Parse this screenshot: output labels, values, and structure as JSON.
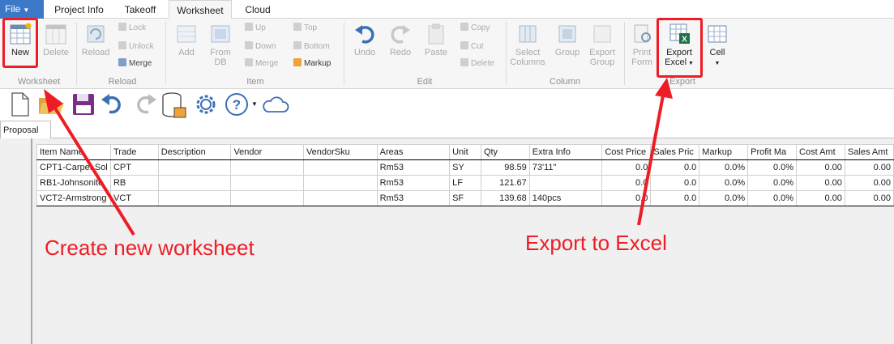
{
  "menu": {
    "file_label": "File",
    "tabs": [
      {
        "label": "Project Info"
      },
      {
        "label": "Takeoff"
      },
      {
        "label": "Worksheet"
      },
      {
        "label": "Cloud"
      }
    ]
  },
  "ribbon": {
    "worksheet_group": {
      "label": "Worksheet",
      "new_label": "New",
      "delete_label": "Delete"
    },
    "reload_group": {
      "label": "Reload",
      "reload_label": "Reload",
      "lock_label": "Lock",
      "unlock_label": "Unlock",
      "merge_label": "Merge"
    },
    "item_group": {
      "label": "Item",
      "add_label": "Add",
      "from_db_line1": "From",
      "from_db_line2": "DB",
      "up_label": "Up",
      "down_label": "Down",
      "merge_label": "Merge",
      "top_label": "Top",
      "bottom_label": "Bottom",
      "markup_label": "Markup"
    },
    "edit_group": {
      "label": "Edit",
      "undo_label": "Undo",
      "redo_label": "Redo",
      "paste_label": "Paste",
      "copy_label": "Copy",
      "cut_label": "Cut",
      "delete_label": "Delete"
    },
    "column_group": {
      "label": "Column",
      "select_columns_line1": "Select",
      "select_columns_line2": "Columns",
      "group_label": "Group",
      "export_group_line1": "Export",
      "export_group_line2": "Group"
    },
    "export_group": {
      "label": "Export",
      "print_form_line1": "Print",
      "print_form_line2": "Form",
      "export_excel_line1": "Export",
      "export_excel_line2": "Excel",
      "cell_label": "Cell"
    }
  },
  "doc_tab": "Proposal",
  "table": {
    "columns": [
      "Item Name",
      "Trade",
      "Description",
      "Vendor",
      "VendorSku",
      "Areas",
      "Unit",
      "Qty",
      "Extra Info",
      "Cost Price",
      "Sales Pric",
      "Markup",
      "Profit Ma",
      "Cost Amt",
      "Sales Amt"
    ],
    "rows": [
      [
        "CPT1-Carpet Sol",
        "CPT",
        "",
        "",
        "",
        "Rm53",
        "SY",
        "98.59",
        "73'11\"",
        "0.0",
        "0.0",
        "0.0%",
        "0.0%",
        "0.00",
        "0.00"
      ],
      [
        "RB1-Johnsonite",
        "RB",
        "",
        "",
        "",
        "Rm53",
        "LF",
        "121.67",
        "",
        "0.0",
        "0.0",
        "0.0%",
        "0.0%",
        "0.00",
        "0.00"
      ],
      [
        "VCT2-Armstrong",
        "VCT",
        "",
        "",
        "",
        "Rm53",
        "SF",
        "139.68",
        "140pcs",
        "0.0",
        "0.0",
        "0.0%",
        "0.0%",
        "0.00",
        "0.00"
      ]
    ]
  },
  "annotations": {
    "left_text": "Create new worksheet",
    "right_text": "Export to Excel",
    "color": "#ee1c25"
  },
  "icons": [
    "new-worksheet-icon",
    "delete-icon",
    "reload-icon",
    "lock-icon",
    "unlock-icon",
    "merge-icon",
    "add-icon",
    "from-db-icon",
    "undo-icon",
    "redo-icon",
    "paste-icon",
    "select-columns-icon",
    "group-icon",
    "export-group-icon",
    "print-form-icon",
    "export-excel-icon",
    "cell-icon",
    "new-file-icon",
    "open-folder-icon",
    "save-icon",
    "database-icon",
    "gear-icon",
    "help-icon",
    "cloud-icon"
  ]
}
